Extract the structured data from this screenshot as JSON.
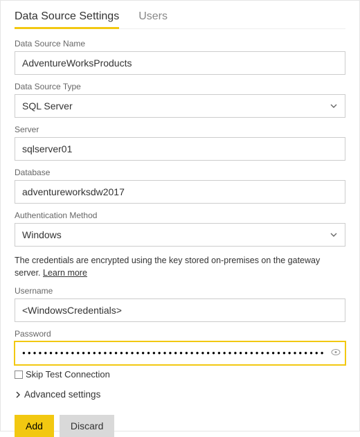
{
  "tabs": {
    "settings": "Data Source Settings",
    "users": "Users"
  },
  "labels": {
    "dataSourceName": "Data Source Name",
    "dataSourceType": "Data Source Type",
    "server": "Server",
    "database": "Database",
    "authMethod": "Authentication Method",
    "username": "Username",
    "password": "Password",
    "skipTest": "Skip Test Connection",
    "advanced": "Advanced settings"
  },
  "values": {
    "dataSourceName": "AdventureWorksProducts",
    "dataSourceType": "SQL Server",
    "server": "sqlserver01",
    "database": "adventureworksdw2017",
    "authMethod": "Windows",
    "username": "<WindowsCredentials>",
    "passwordMask": "●●●●●●●●●●●●●●●●●●●●●●●●●●●●●●●●●●●●●●●●●●●●●●●●●●●●●●●●●●●●●●●●●●●●●●●●●●●●●"
  },
  "note": {
    "text": "The credentials are encrypted using the key stored on-premises on the gateway server. ",
    "link": "Learn more"
  },
  "buttons": {
    "add": "Add",
    "discard": "Discard"
  }
}
